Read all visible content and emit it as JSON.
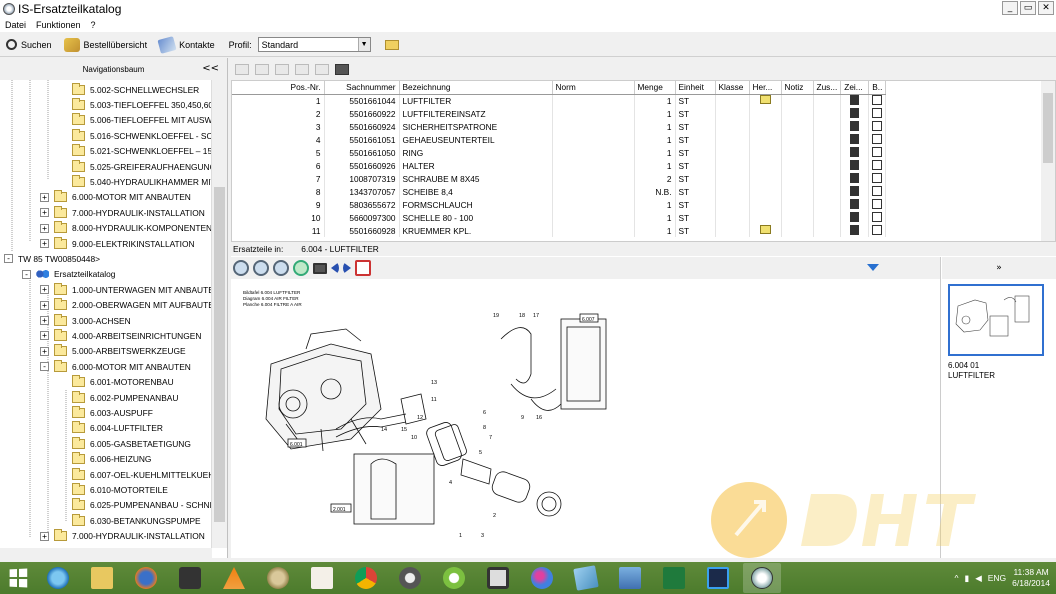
{
  "window": {
    "title": "IS-Ersatzteilkatalog",
    "controls": [
      "_",
      "▭",
      "✕"
    ]
  },
  "menu": [
    "Datei",
    "Funktionen",
    "?"
  ],
  "toolbar": {
    "search": "Suchen",
    "orders": "Bestellübersicht",
    "contacts": "Kontakte",
    "profile_label": "Profil:",
    "profile_value": "Standard"
  },
  "nav": {
    "title": "Navigationsbaum",
    "collapse": "<<",
    "items": [
      {
        "label": "5.002-SCHNELLWECHSLER",
        "level": 4,
        "exp": ""
      },
      {
        "label": "5.003-TIEFLOEFFEL 350,450,60",
        "level": 4,
        "exp": ""
      },
      {
        "label": "5.006-TIEFLOEFFEL MIT AUSW",
        "level": 4,
        "exp": ""
      },
      {
        "label": "5.016-SCHWENKLOEFFEL - SC",
        "level": 4,
        "exp": ""
      },
      {
        "label": "5.021-SCHWENKLOEFFEL – 15",
        "level": 4,
        "exp": ""
      },
      {
        "label": "5.025-GREIFERAUFHAENGUNG",
        "level": 4,
        "exp": ""
      },
      {
        "label": "5.040-HYDRAULIKHAMMER MIT",
        "level": 4,
        "exp": ""
      },
      {
        "label": "6.000-MOTOR MIT ANBAUTEN",
        "level": 3,
        "exp": "+"
      },
      {
        "label": "7.000-HYDRAULIK-INSTALLATION",
        "level": 3,
        "exp": "+"
      },
      {
        "label": "8.000-HYDRAULIK-KOMPONENTEN",
        "level": 3,
        "exp": "+"
      },
      {
        "label": "9.000-ELEKTRIKINSTALLATION",
        "level": 3,
        "exp": "+"
      },
      {
        "label": "TW 85 TW00850448>",
        "level": 1,
        "exp": "-",
        "type": "machine"
      },
      {
        "label": "Ersatzteilkatalog",
        "level": 2,
        "exp": "-",
        "type": "catalog"
      },
      {
        "label": "1.000-UNTERWAGEN MIT ANBAUTE",
        "level": 3,
        "exp": "+"
      },
      {
        "label": "2.000-OBERWAGEN MIT AUFBAUTE",
        "level": 3,
        "exp": "+"
      },
      {
        "label": "3.000-ACHSEN",
        "level": 3,
        "exp": "+"
      },
      {
        "label": "4.000-ARBEITSEINRICHTUNGEN",
        "level": 3,
        "exp": "+"
      },
      {
        "label": "5.000-ARBEITSWERKZEUGE",
        "level": 3,
        "exp": "+"
      },
      {
        "label": "6.000-MOTOR MIT ANBAUTEN",
        "level": 3,
        "exp": "-"
      },
      {
        "label": "6.001-MOTORENBAU",
        "level": 4,
        "exp": ""
      },
      {
        "label": "6.002-PUMPENANBAU",
        "level": 4,
        "exp": ""
      },
      {
        "label": "6.003-AUSPUFF",
        "level": 4,
        "exp": ""
      },
      {
        "label": "6.004-LUFTFILTER",
        "level": 4,
        "exp": ""
      },
      {
        "label": "6.005-GASBETAETIGUNG",
        "level": 4,
        "exp": ""
      },
      {
        "label": "6.006-HEIZUNG",
        "level": 4,
        "exp": ""
      },
      {
        "label": "6.007-OEL-KUEHLMITTELKUEH",
        "level": 4,
        "exp": ""
      },
      {
        "label": "6.010-MOTORTEILE",
        "level": 4,
        "exp": ""
      },
      {
        "label": "6.025-PUMPENANBAU - SCHNE",
        "level": 4,
        "exp": ""
      },
      {
        "label": "6.030-BETANKUNGSPUMPE",
        "level": 4,
        "exp": ""
      },
      {
        "label": "7.000-HYDRAULIK-INSTALLATION",
        "level": 3,
        "exp": "+"
      }
    ]
  },
  "table": {
    "columns": [
      "Pos.-Nr.",
      "Sachnummer",
      "Bezeichnung",
      "Norm",
      "Menge",
      "Einheit",
      "Klasse",
      "Her...",
      "Notiz",
      "Zus...",
      "Zei...",
      "B.."
    ],
    "rows": [
      {
        "pos": "1",
        "nr": "5501661044",
        "name": "LUFTFILTER",
        "qty": "1",
        "unit": "ST",
        "her": true
      },
      {
        "pos": "2",
        "nr": "5501660922",
        "name": "LUFTFILTEREINSATZ",
        "qty": "1",
        "unit": "ST",
        "her": false
      },
      {
        "pos": "3",
        "nr": "5501660924",
        "name": "SICHERHEITSPATRONE",
        "qty": "1",
        "unit": "ST",
        "her": false
      },
      {
        "pos": "4",
        "nr": "5501661051",
        "name": "GEHAEUSEUNTERTEIL",
        "qty": "1",
        "unit": "ST",
        "her": false
      },
      {
        "pos": "5",
        "nr": "5501661050",
        "name": "RING",
        "qty": "1",
        "unit": "ST",
        "her": false
      },
      {
        "pos": "6",
        "nr": "5501660926",
        "name": "HALTER",
        "qty": "1",
        "unit": "ST",
        "her": false
      },
      {
        "pos": "7",
        "nr": "1008707319",
        "name": "SCHRAUBE M 8X45",
        "qty": "2",
        "unit": "ST",
        "her": false
      },
      {
        "pos": "8",
        "nr": "1343707057",
        "name": "SCHEIBE 8,4",
        "qty": "N.B.",
        "unit": "ST",
        "her": false
      },
      {
        "pos": "9",
        "nr": "5803655672",
        "name": "FORMSCHLAUCH",
        "qty": "1",
        "unit": "ST",
        "her": false
      },
      {
        "pos": "10",
        "nr": "5660097300",
        "name": "SCHELLE 80 - 100",
        "qty": "1",
        "unit": "ST",
        "her": false
      },
      {
        "pos": "11",
        "nr": "5501660928",
        "name": "KRUEMMER KPL.",
        "qty": "1",
        "unit": "ST",
        "her": true
      }
    ]
  },
  "info": {
    "label": "Ersatzteile in:",
    "value": "6.004 - LUFTFILTER"
  },
  "thumbs": {
    "header": "»",
    "caption_line1": "6.004 01",
    "caption_line2": "LUFTFILTER"
  },
  "drawing": {
    "callouts": [
      "1",
      "2",
      "3",
      "4",
      "5",
      "6",
      "7",
      "8",
      "9",
      "10",
      "11",
      "12",
      "13",
      "14",
      "15",
      "16",
      "17",
      "18",
      "19"
    ],
    "boxes": [
      "6.001",
      "2.001",
      "6.007"
    ],
    "title_block": {
      "line1": "Bildtafel 6.004   LUFTFILTER",
      "line2": "Diagram 6.004   AIR FILTER",
      "line3": "Planche 6.004   FILTRE A AIR"
    }
  },
  "taskbar": {
    "language": "ENG",
    "time": "11:38 AM",
    "date": "6/18/2014"
  },
  "colors": {
    "taskbar": "#55832f",
    "selection": "#3070d0",
    "folder": "#fbe99c"
  }
}
